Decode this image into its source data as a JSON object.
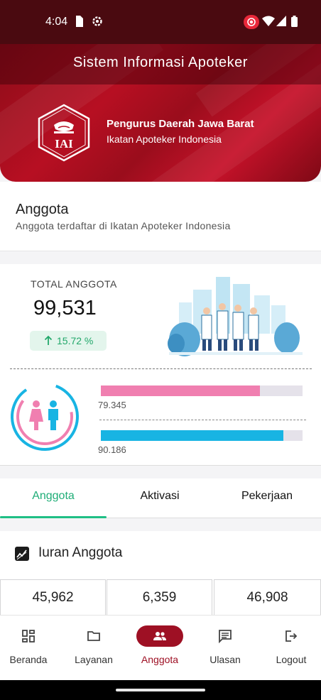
{
  "status_bar": {
    "time": "4:04",
    "icons": [
      "sim-card-icon",
      "settings-gear-icon",
      "screen-record-icon",
      "wifi-icon",
      "cellular-signal-icon",
      "battery-icon"
    ]
  },
  "header": {
    "app_title": "Sistem Informasi Apoteker",
    "logo_text": "IAI",
    "org_name": "Pengurus Daerah Jawa Barat",
    "org_subtitle": "Ikatan Apoteker Indonesia",
    "brand_color": "#b70f22"
  },
  "page": {
    "title": "Anggota",
    "subtitle": "Anggota terdaftar di Ikatan Apoteker Indonesia"
  },
  "stats": {
    "total_label": "TOTAL ANGGOTA",
    "total_value": "99,531",
    "growth": "15.72 %",
    "growth_color": "#23a86b",
    "female": {
      "value": "79.345",
      "fraction": 0.79,
      "color": "#f07fb0"
    },
    "male": {
      "value": "90.186",
      "fraction": 0.905,
      "color": "#18b4e3"
    }
  },
  "tabs": [
    {
      "label": "Anggota",
      "active": true
    },
    {
      "label": "Aktivasi",
      "active": false
    },
    {
      "label": "Pekerjaan",
      "active": false
    }
  ],
  "iuran": {
    "title": "Iuran Anggota",
    "values": [
      "45,962",
      "6,359",
      "46,908"
    ]
  },
  "bottom_nav": [
    {
      "label": "Beranda",
      "icon": "dashboard-icon",
      "active": false
    },
    {
      "label": "Layanan",
      "icon": "folder-icon",
      "active": false
    },
    {
      "label": "Anggota",
      "icon": "people-icon",
      "active": true
    },
    {
      "label": "Ulasan",
      "icon": "comment-icon",
      "active": false
    },
    {
      "label": "Logout",
      "icon": "logout-icon",
      "active": false
    }
  ]
}
